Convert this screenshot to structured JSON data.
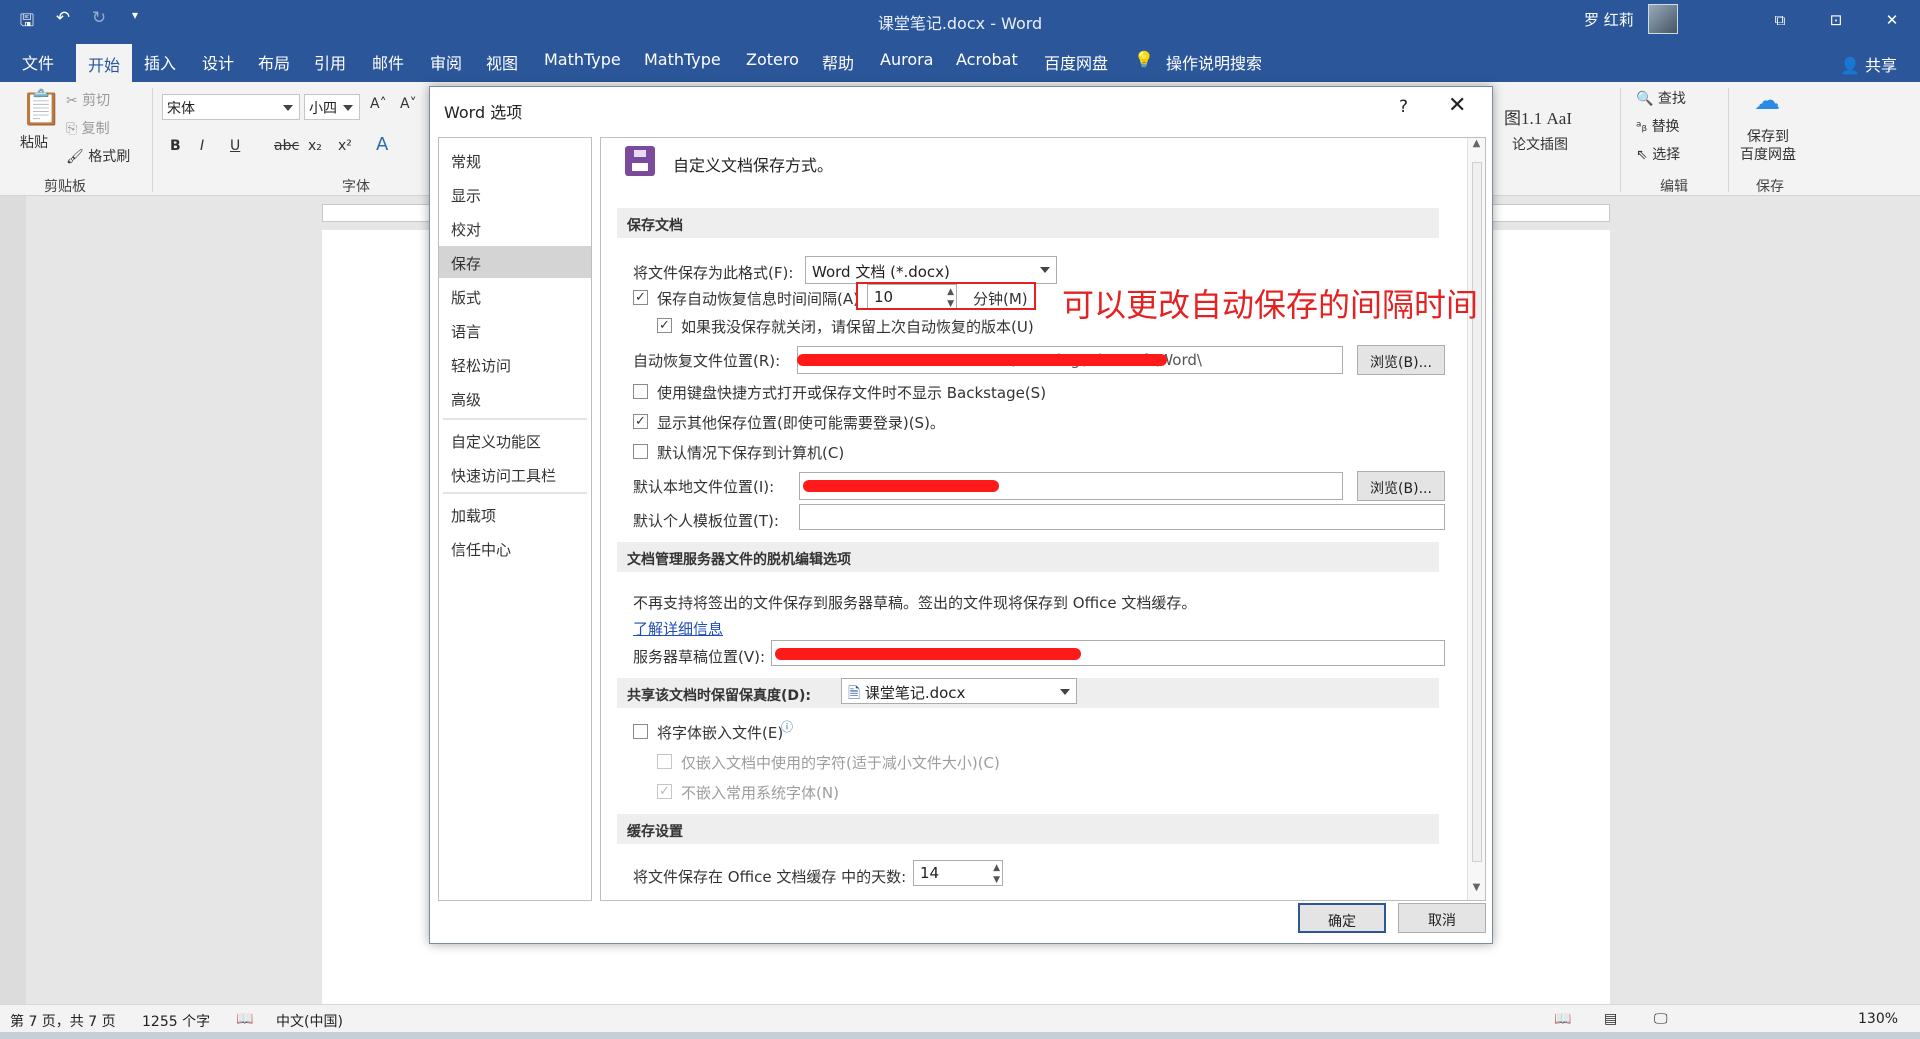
{
  "window": {
    "doc_title": "课堂笔记.docx  -  Word",
    "user_name": "罗 红莉",
    "controls": [
      "⧉",
      "⊡",
      "✕"
    ]
  },
  "ribbon": {
    "tabs": [
      "文件",
      "开始",
      "插入",
      "设计",
      "布局",
      "引用",
      "邮件",
      "审阅",
      "视图",
      "MathType",
      "MathType",
      "Zotero",
      "帮助",
      "Aurora",
      "Acrobat",
      "百度网盘",
      "操作说明搜索"
    ],
    "share": "共享",
    "clipboard": {
      "paste": "粘贴",
      "cut": "剪切",
      "copy": "复制",
      "format_painter": "格式刷",
      "group": "剪贴板"
    },
    "font": {
      "name": "宋体",
      "size": "小四",
      "group": "字体"
    },
    "styles": {
      "sample": "图1.1  AaI",
      "name": "论文插图"
    },
    "edit": {
      "find": "查找",
      "replace": "替换",
      "select": "选择",
      "group": "编辑"
    },
    "save": {
      "label": "保存到\n百度网盘",
      "group": "保存"
    }
  },
  "status": {
    "page": "第 7 页，共 7 页",
    "words": "1255 个字",
    "language": "中文(中国)",
    "zoom": "130%"
  },
  "dialog": {
    "title": "Word 选项",
    "help": "?",
    "close": "✕",
    "nav": [
      "常规",
      "显示",
      "校对",
      "保存",
      "版式",
      "语言",
      "轻松访问",
      "高级",
      "自定义功能区",
      "快速访问工具栏",
      "加载项",
      "信任中心"
    ],
    "selected_nav": "保存",
    "header": "自定义文档保存方式。",
    "sections": {
      "save_docs": "保存文档",
      "offline": "文档管理服务器文件的脱机编辑选项",
      "fidelity": "共享该文档时保留保真度(D):",
      "cache": "缓存设置"
    },
    "save_format_label": "将文件保存为此格式(F):",
    "save_format_value": "Word 文档 (*.docx)",
    "autorecover_label": "保存自动恢复信息时间间隔(A)",
    "autorecover_minutes": "10",
    "minutes_label": "分钟(M)",
    "keep_last_label": "如果我没保存就关闭，请保留上次自动恢复的版本(U)",
    "autorecover_location_label": "自动恢复文件位置(R):",
    "autorecover_location_value": "…\\Roaming\\Microsoft\\Word\\",
    "browse": "浏览(B)...",
    "no_backstage_label": "使用键盘快捷方式打开或保存文件时不显示 Backstage(S)",
    "show_other_label": "显示其他保存位置(即使可能需要登录)(S)。",
    "default_computer_label": "默认情况下保存到计算机(C)",
    "default_local_label": "默认本地文件位置(I):",
    "default_template_label": "默认个人模板位置(T):",
    "offline_note": "不再支持将签出的文件保存到服务器草稿。签出的文件现将保存到 Office 文档缓存。",
    "learn_more": "了解详细信息",
    "server_drafts_label": "服务器草稿位置(V):",
    "fidelity_doc": "课堂笔记.docx",
    "embed_fonts_label": "将字体嵌入文件(E)",
    "embed_used_label": "仅嵌入文档中使用的字符(适于减小文件大小)(C)",
    "no_common_label": "不嵌入常用系统字体(N)",
    "cache_days_label": "将文件保存在 Office 文档缓存 中的天数:",
    "cache_days_value": "14",
    "ok": "确定",
    "cancel": "取消",
    "checks": {
      "autorecover": true,
      "keep_last": true,
      "no_backstage": false,
      "show_other": true,
      "default_computer": false,
      "embed_fonts": false,
      "embed_used": false,
      "no_common": true
    }
  },
  "annotation": "可以更改自动保存的间隔时间",
  "colors": {
    "word_blue": "#2b579a",
    "annotation_red": "#e52222"
  }
}
